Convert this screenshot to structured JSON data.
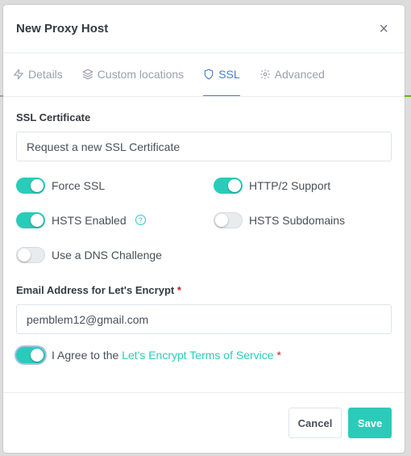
{
  "modal": {
    "title": "New Proxy Host",
    "close_glyph": "×"
  },
  "tabs": [
    {
      "label": "Details",
      "icon": "bolt-icon",
      "active": false
    },
    {
      "label": "Custom locations",
      "icon": "layers-icon",
      "active": false
    },
    {
      "label": "SSL",
      "icon": "shield-icon",
      "active": true
    },
    {
      "label": "Advanced",
      "icon": "gear-icon",
      "active": false
    }
  ],
  "ssl": {
    "certificate_label": "SSL Certificate",
    "certificate_value": "Request a new SSL Certificate",
    "switches": {
      "force_ssl": {
        "label": "Force SSL",
        "on": true
      },
      "http2": {
        "label": "HTTP/2 Support",
        "on": true
      },
      "hsts": {
        "label": "HSTS Enabled",
        "on": true
      },
      "hsts_subdomains": {
        "label": "HSTS Subdomains",
        "on": false
      },
      "dns_challenge": {
        "label": "Use a DNS Challenge",
        "on": false
      }
    },
    "email_label": "Email Address for Let's Encrypt",
    "required_mark": "*",
    "email_value": "pemblem12@gmail.com",
    "agree_prefix": "I Agree to the",
    "agree_link": "Let's Encrypt Terms of Service",
    "agree_on": true
  },
  "footer": {
    "cancel_label": "Cancel",
    "save_label": "Save"
  },
  "colors": {
    "accent": "#2bcbba",
    "tab_active": "#467fcf",
    "required": "#cd201f"
  }
}
